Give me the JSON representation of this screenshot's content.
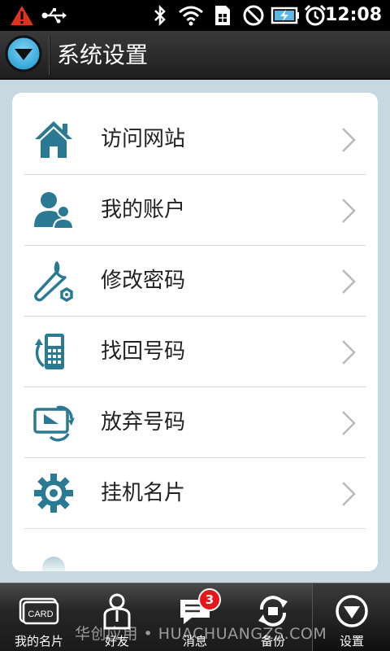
{
  "status_bar": {
    "time": "12:08",
    "icons": [
      "warning-icon",
      "usb-icon",
      "bluetooth-icon",
      "wifi-icon",
      "sim-icon",
      "no-sim-icon",
      "battery-charging-icon",
      "alarm-icon"
    ]
  },
  "header": {
    "title": "系统设置",
    "menu_icon": "chevron-down-circle-icon"
  },
  "menu": {
    "items": [
      {
        "label": "访问网站",
        "icon": "home-icon"
      },
      {
        "label": "我的账户",
        "icon": "user-account-icon"
      },
      {
        "label": "修改密码",
        "icon": "wrench-icon"
      },
      {
        "label": "找回号码",
        "icon": "phone-refresh-icon"
      },
      {
        "label": "放弃号码",
        "icon": "abandon-number-icon"
      },
      {
        "label": "挂机名片",
        "icon": "gear-icon"
      }
    ]
  },
  "tab_bar": {
    "tabs": [
      {
        "label": "我的名片",
        "icon": "card-icon"
      },
      {
        "label": "好友",
        "icon": "friend-icon"
      },
      {
        "label": "消息",
        "icon": "message-icon",
        "badge": "3"
      },
      {
        "label": "备份",
        "icon": "backup-icon"
      },
      {
        "label": "设置",
        "icon": "settings-down-icon"
      }
    ],
    "card_icon_text": "CARD"
  },
  "watermark": "华创应用 • HUACHUANGZS.COM",
  "colors": {
    "accent": "#2b7a93",
    "title_bar": "#2a2a2a",
    "badge": "#e8161b",
    "background": "#c8d8e0"
  }
}
